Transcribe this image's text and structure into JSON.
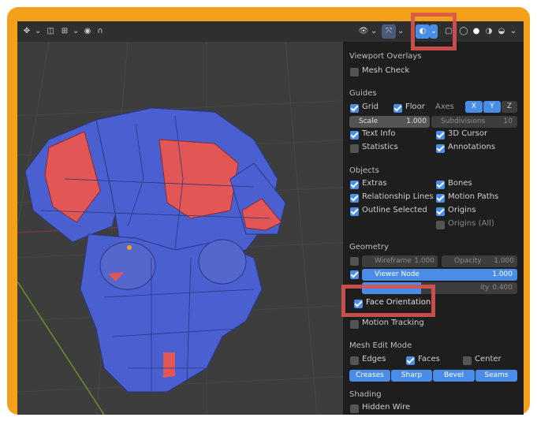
{
  "header": {
    "left_icons": [
      "cursor-icon",
      "view-icon",
      "snap-icon",
      "proportional-icon"
    ],
    "right_icons": [
      "visibility-icon",
      "gizmo-icon",
      "overlay-icon",
      "xray-icon",
      "shading-wire-icon",
      "shading-solid-icon",
      "shading-material-icon",
      "shading-rendered-icon"
    ]
  },
  "panel": {
    "title": "Viewport Overlays",
    "mesh_check": "Mesh Check",
    "guides": {
      "heading": "Guides",
      "grid": "Grid",
      "floor": "Floor",
      "axes": "Axes",
      "x": "X",
      "y": "Y",
      "z": "Z",
      "scale_label": "Scale",
      "scale_value": "1.000",
      "subdivisions_label": "Subdivisions",
      "subdivisions_value": "10",
      "text_info": "Text Info",
      "cursor_3d": "3D Cursor",
      "statistics": "Statistics",
      "annotations": "Annotations"
    },
    "objects": {
      "heading": "Objects",
      "extras": "Extras",
      "bones": "Bones",
      "relationship_lines": "Relationship Lines",
      "motion_paths": "Motion Paths",
      "outline_selected": "Outline Selected",
      "origins": "Origins",
      "origins_all": "Origins (All)"
    },
    "geometry": {
      "heading": "Geometry",
      "wireframe_label": "Wireframe",
      "wireframe_value": "1.000",
      "opacity_label": "Opacity",
      "opacity_value": "1.000",
      "viewer_node_label": "Viewer Node",
      "viewer_node_value": "1.000",
      "hidden_value_label": "ity",
      "hidden_value": "0.400",
      "face_orientation": "Face Orientation",
      "motion_tracking": "Motion Tracking"
    },
    "mesh_edit": {
      "heading": "Mesh Edit Mode",
      "edges": "Edges",
      "faces": "Faces",
      "center": "Center",
      "creases": "Creases",
      "sharp": "Sharp",
      "bevel": "Bevel",
      "seams": "Seams"
    },
    "shading": {
      "heading": "Shading",
      "hidden_wire": "Hidden Wire"
    }
  },
  "colors": {
    "frame": "#f5a01b",
    "highlight": "#d9534f",
    "mesh_front": "#4a5fd0",
    "mesh_back": "#e05050",
    "accent": "#4a8de8"
  }
}
